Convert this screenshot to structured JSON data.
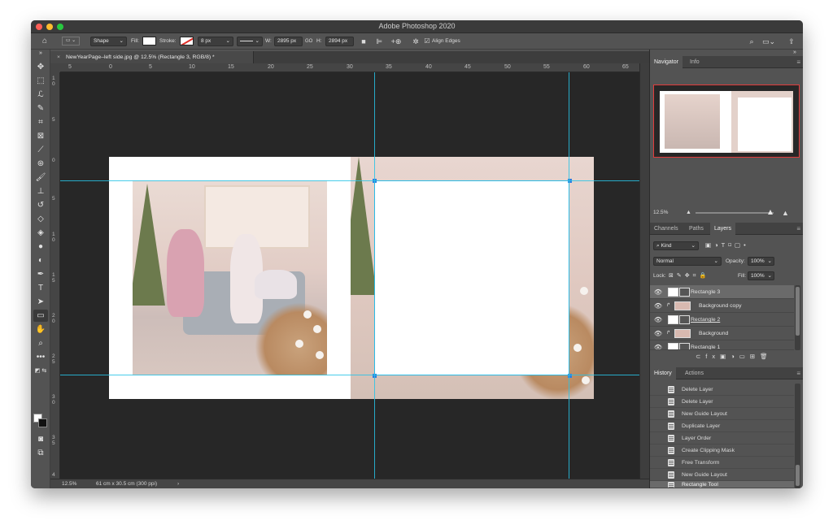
{
  "app": {
    "title": "Adobe Photoshop 2020"
  },
  "options_bar": {
    "shape_mode": "Shape",
    "fill_label": "Fill:",
    "stroke_label": "Stroke:",
    "stroke_width": "8 px",
    "w_label": "W:",
    "w_value": "2895 px",
    "link_label": "GO",
    "h_label": "H:",
    "h_value": "2894 px",
    "align_edges": "Align Edges"
  },
  "document": {
    "tab_title": "NewYearPage–left side.jpg @ 12.5% (Rectangle 3, RGB/8) *",
    "zoom": "12.5%",
    "dimensions": "61 cm x 30.5 cm (300 ppi)"
  },
  "ruler_top": [
    "5",
    "0",
    "5",
    "10",
    "15",
    "20",
    "25",
    "30",
    "35",
    "40",
    "45",
    "50",
    "55",
    "60",
    "65"
  ],
  "ruler_left": [
    "1\n0",
    "5",
    "0",
    "5",
    "1\n0",
    "1\n5",
    "2\n0",
    "2\n5",
    "3\n0",
    "3\n5",
    "4"
  ],
  "panels": {
    "navigator": {
      "tabs": [
        "Navigator",
        "Info"
      ],
      "zoom": "12.5%"
    },
    "layers": {
      "tabs": [
        "Channels",
        "Paths",
        "Layers"
      ],
      "filter_kind": "Kind",
      "blend_mode": "Normal",
      "opacity_label": "Opacity:",
      "opacity": "100%",
      "lock_label": "Lock:",
      "fill_label": "Fill:",
      "fill": "100%",
      "items": [
        {
          "name": "Rectangle 3",
          "selected": true
        },
        {
          "name": "Background copy",
          "selected": false
        },
        {
          "name": "Rectangle 2",
          "selected": false
        },
        {
          "name": "Background",
          "selected": false
        },
        {
          "name": "Rectangle 1",
          "selected": false
        }
      ]
    },
    "history": {
      "tabs": [
        "History",
        "Actions"
      ],
      "items": [
        "Delete Layer",
        "Delete Layer",
        "New Guide Layout",
        "Duplicate Layer",
        "Layer Order",
        "Create Clipping Mask",
        "Free Transform",
        "New Guide Layout",
        "Rectangle Tool"
      ]
    }
  },
  "colors": {
    "guide": "#28c3e6",
    "selection": "#2d7fe0",
    "navigator_frame": "#e23b3b"
  }
}
